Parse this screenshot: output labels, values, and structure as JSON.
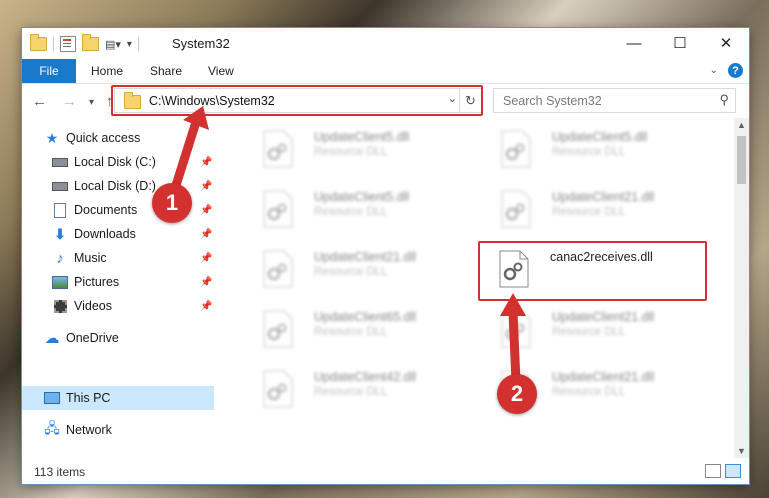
{
  "window": {
    "title": "System32",
    "controls": {
      "minimize": "—",
      "maximize": "☐",
      "close": "✕"
    }
  },
  "ribbon": {
    "tabs": [
      {
        "label": "File",
        "active": true
      },
      {
        "label": "Home"
      },
      {
        "label": "Share"
      },
      {
        "label": "View"
      }
    ],
    "help_label": "?"
  },
  "address": {
    "path": "C:\\Windows\\System32",
    "search_placeholder": "Search System32"
  },
  "sidebar": {
    "items": [
      {
        "label": "Quick access",
        "icon": "star-icon"
      },
      {
        "label": "Local Disk (C:)",
        "icon": "drive-icon",
        "pinned": true
      },
      {
        "label": "Local Disk (D:)",
        "icon": "drive-icon",
        "pinned": true
      },
      {
        "label": "Documents",
        "icon": "documents-icon",
        "pinned": true
      },
      {
        "label": "Downloads",
        "icon": "downloads-icon",
        "pinned": true
      },
      {
        "label": "Music",
        "icon": "music-icon",
        "pinned": true
      },
      {
        "label": "Pictures",
        "icon": "pictures-icon",
        "pinned": true
      },
      {
        "label": "Videos",
        "icon": "videos-icon",
        "pinned": true
      },
      {
        "label": "OneDrive",
        "icon": "onedrive-icon"
      },
      {
        "label": "This PC",
        "icon": "computer-icon",
        "selected": true
      },
      {
        "label": "Network",
        "icon": "network-icon"
      }
    ]
  },
  "files": [
    {
      "name": "UpdateClient5.dll",
      "type": "Resource DLL",
      "blurred": true
    },
    {
      "name": "UpdateClient5.dll",
      "type": "Resource DLL",
      "blurred": true
    },
    {
      "name": "UpdateClient5.dll",
      "type": "Resource DLL",
      "blurred": true
    },
    {
      "name": "UpdateClient21.dll",
      "type": "Resource DLL",
      "blurred": true
    },
    {
      "name": "UpdateClient21.dll",
      "type": "Resource DLL",
      "blurred": true
    },
    {
      "name": "canac2receives.dll",
      "type": "",
      "blurred": false,
      "highlighted": true
    },
    {
      "name": "UpdateClient65.dll",
      "type": "Resource DLL",
      "blurred": true
    },
    {
      "name": "UpdateClient21.dll",
      "type": "Resource DLL",
      "blurred": true
    },
    {
      "name": "UpdateClient42.dll",
      "type": "Resource DLL",
      "blurred": true
    },
    {
      "name": "UpdateClient21.dll",
      "type": "Resource DLL",
      "blurred": true
    }
  ],
  "status": {
    "item_count": "113 items"
  },
  "annotations": {
    "step1": "1",
    "step2": "2",
    "color": "#d2312f"
  }
}
